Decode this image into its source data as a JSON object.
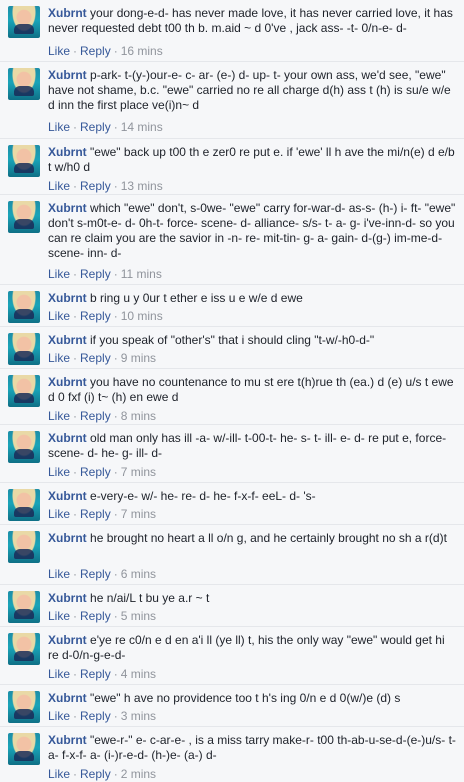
{
  "comments": [
    {
      "author": "Xubrnt",
      "text": "your dong-e-d- has never made love, it has never carried love, it has never requested debt t00 th b. m.aid ~ d 0've , jack ass- -t- 0/n-e- d-",
      "like": "Like",
      "reply": "Reply",
      "time": "16 mins"
    },
    {
      "author": "Xubrnt",
      "text": "p-ark- t-(y-)our-e- c- ar- (e-) d- up- t- your own ass, we'd see, \"ewe\" have not shame, b.c. \"ewe\" carried no re all charge d(h) ass t (h) is su/e w/e d inn the first place ve(i)n~ d",
      "like": "Like",
      "reply": "Reply",
      "time": "14 mins"
    },
    {
      "author": "Xubrnt",
      "text": "\"ewe\" back up t00 th e zer0 re put e. if 'ewe' ll h ave the mi/n(e) d e/b t w/h0 d",
      "like": "Like",
      "reply": "Reply",
      "time": "13 mins"
    },
    {
      "author": "Xubrnt",
      "text": "which \"ewe\" don't, s-0we- \"ewe\" carry for-war-d- as-s- (h-) i- ft- \"ewe\" don't s-m0t-e- d- 0h-t- force- scene- d- alliance- s/s- t- a- g- i've-inn-d- so you can re claim you are the savior in -n- re- mit-tin- g- a- gain- d-(g-) im-me-d- scene- inn- d-",
      "like": "Like",
      "reply": "Reply",
      "time": "11 mins"
    },
    {
      "author": "Xubrnt",
      "text": "b ring u y 0ur t ether e iss u e w/e d ewe",
      "like": "Like",
      "reply": "Reply",
      "time": "10 mins"
    },
    {
      "author": "Xubrnt",
      "text": "if you speak of \"other's\" that i should cling \"t-w/-h0-d-\"",
      "like": "Like",
      "reply": "Reply",
      "time": "9 mins"
    },
    {
      "author": "Xubrnt",
      "text": "you have no countenance to mu st ere t(h)rue th (ea.) d (e) u/s t ewe d 0 fxf (i) t~ (h) en ewe d",
      "like": "Like",
      "reply": "Reply",
      "time": "8 mins"
    },
    {
      "author": "Xubrnt",
      "text": "old man only has ill -a- w/-ill- t-00-t- he- s- t- ill- e- d- re put e, force-scene- d- he- g- ill- d-",
      "like": "Like",
      "reply": "Reply",
      "time": "7 mins"
    },
    {
      "author": "Xubrnt",
      "text": "e-very-e- w/- he- re- d- he- f-x-f- eeL- d- 's-",
      "like": "Like",
      "reply": "Reply",
      "time": "7 mins"
    },
    {
      "author": "Xubrnt",
      "text": "he brought no heart a ll o/n g, and he certainly brought no sh a r(d)t",
      "like": "Like",
      "reply": "Reply",
      "time": "6 mins"
    },
    {
      "author": "Xubrnt",
      "text": "he n/ai/L t bu ye a.r ~ t",
      "like": "Like",
      "reply": "Reply",
      "time": "5 mins"
    },
    {
      "author": "Xubrnt",
      "text": "e'ye re c0/n e d en a'i ll (ye ll) t, his the only way \"ewe\" would get hi re d-0/n-g-e-d-",
      "like": "Like",
      "reply": "Reply",
      "time": "4 mins"
    },
    {
      "author": "Xubrnt",
      "text": "\"ewe\" h ave no providence too t h's ing 0/n e d 0(w/)e (d) s",
      "like": "Like",
      "reply": "Reply",
      "time": "3 mins"
    },
    {
      "author": "Xubrnt",
      "text": "\"ewe-r-\" e- c-ar-e- , is a miss tarry make-r- t00 th-ab-u-se-d-(e-)u/s- t- a- f-x-f- a- (i-)r-e-d- (h-)e- (a-) d-",
      "like": "Like",
      "reply": "Reply",
      "time": "2 mins"
    }
  ]
}
